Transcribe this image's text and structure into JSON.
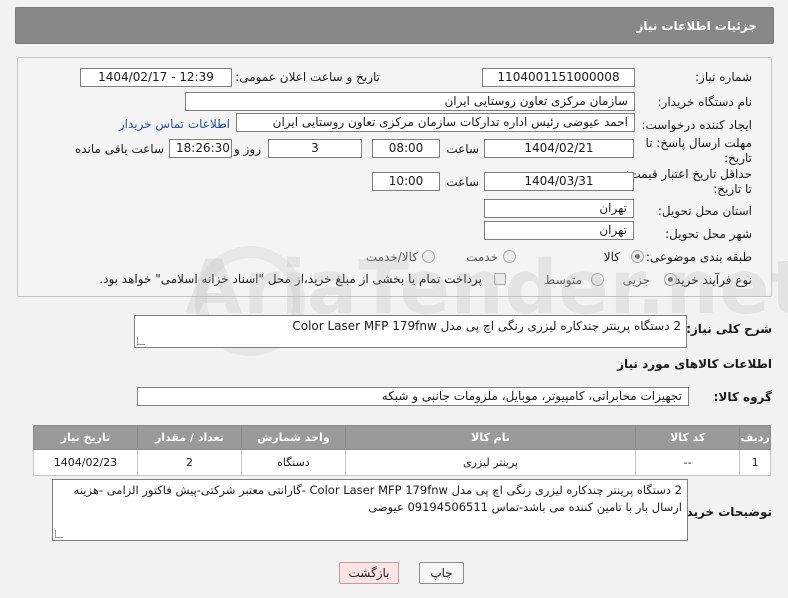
{
  "header": {
    "title": "جزئیات اطلاعات نیاز"
  },
  "fields": {
    "need_number_label": "شماره نیاز:",
    "need_number": "1104001151000008",
    "announce_label": "تاریخ و ساعت اعلان عمومی:",
    "announce_value": "1404/02/17 - 12:39",
    "buyer_org_label": "نام دستگاه خریدار:",
    "buyer_org": "سازمان مرکزی تعاون روستایی ایران",
    "creator_label": "ایجاد کننده درخواست:",
    "creator": "احمد عیوضی رئیس اداره تدارکات سازمان مرکزی تعاون روستایی ایران",
    "contact_link": "اطلاعات تماس خریدار",
    "reply_deadline_label": "مهلت ارسال پاسخ: تا تاریخ:",
    "reply_date": "1404/02/21",
    "time_label": "ساعت",
    "reply_time": "08:00",
    "days_value": "3",
    "days_label": "روز و",
    "remaining_time": "18:26:30",
    "remaining_label": "ساعت باقی مانده",
    "price_deadline_label": "حداقل تاریخ اعتبار قیمت: تا تاریخ:",
    "price_date": "1404/03/31",
    "price_time": "10:00",
    "province_label": "استان محل تحویل:",
    "province": "تهران",
    "city_label": "شهر محل تحویل:",
    "city": "تهران",
    "category_label": "طبقه بندی موضوعی:",
    "category_options": [
      "کالا",
      "خدمت",
      "کالا/خدمت"
    ],
    "process_label": "نوع فرآیند خرید :",
    "process_options": [
      "جزیی",
      "متوسط"
    ],
    "payment_note": "پرداخت تمام یا بخشی از مبلغ خرید،از محل \"اسناد خزانه اسلامی\" خواهد بود."
  },
  "general_desc": {
    "label": "شرح کلی نیاز:",
    "value": "2 دستگاه پرینتر چندکاره لیزری رنگی اچ پی مدل Color Laser MFP 179fnw"
  },
  "goods_section": {
    "title": "اطلاعات کالاهای مورد نیاز",
    "group_label": "گروه کالا:",
    "group_value": "تجهیزات مخابراتی، کامپیوتر، موبایل، ملزومات جانبی و شبکه"
  },
  "table": {
    "headers": [
      "ردیف",
      "کد کالا",
      "نام کالا",
      "واحد شمارش",
      "تعداد / مقدار",
      "تاریخ نیاز"
    ],
    "rows": [
      [
        "1",
        "--",
        "پرینتر لیزری",
        "دستگاه",
        "2",
        "1404/02/23"
      ]
    ]
  },
  "buyer_notes": {
    "label": "توضیحات خریدار:",
    "line1": "2 دستگاه پرینتر چندکاره لیزری رنگی اچ پی مدل Color Laser MFP 179fnw -گارانتی معتبر شرکتی-پیش فاکتور الزامی -هزینه",
    "line2": "ارسال بار با تامین کننده می باشد-تماس 09194506511 عیوضی"
  },
  "buttons": {
    "print": "چاپ",
    "back": "بازگشت"
  },
  "watermark": "AriaTender.net"
}
